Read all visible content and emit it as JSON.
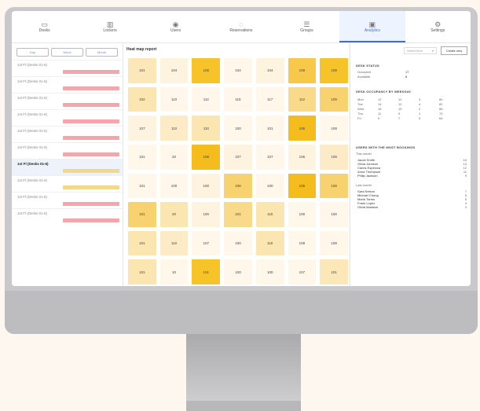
{
  "nav": {
    "items": [
      {
        "label": "Desks",
        "icon": "desk-icon",
        "active": false
      },
      {
        "label": "Lockers",
        "icon": "lockers-icon",
        "active": false
      },
      {
        "label": "Users",
        "icon": "user-icon",
        "active": false
      },
      {
        "label": "Reservations",
        "icon": "reservation-icon",
        "active": false
      },
      {
        "label": "Groups",
        "icon": "groups-icon",
        "active": false
      },
      {
        "label": "Analytics",
        "icon": "analytics-icon",
        "active": true
      },
      {
        "label": "Settings",
        "icon": "settings-icon",
        "active": false
      }
    ]
  },
  "filters": {
    "segments": [
      {
        "label": "Day",
        "active": false
      },
      {
        "label": "Week",
        "active": false
      },
      {
        "label": "Month",
        "active": false
      }
    ]
  },
  "floors": [
    {
      "label": "1st Fl (Desks 01-6)",
      "color": "#f4a6ac",
      "selected": false
    },
    {
      "label": "1st Fl (Desks 01-6)",
      "color": "#f4a6ac",
      "selected": false
    },
    {
      "label": "1st Fl (Desks 01-6)",
      "color": "#f4a6ac",
      "selected": false
    },
    {
      "label": "1st Fl (Desks 01-6)",
      "color": "#f4a6ac",
      "selected": false
    },
    {
      "label": "1st Fl (Desks 01-6)",
      "color": "#f4a6ac",
      "selected": false
    },
    {
      "label": "1st Fl (Desks 01-6)",
      "color": "#f4a6ac",
      "selected": false
    },
    {
      "label": "1st Fl (Desks 01-6)",
      "color": "#f2d88a",
      "selected": true
    },
    {
      "label": "1st Fl (Desks 01-6)",
      "color": "#f2d88a",
      "selected": false
    },
    {
      "label": "1st Fl (Desks 01-6)",
      "color": "#f4a6ac",
      "selected": false
    },
    {
      "label": "1st Fl (Desks 01-6)",
      "color": "#f4a6ac",
      "selected": false
    }
  ],
  "main": {
    "title": "Heat map report"
  },
  "heatmap": [
    [
      {
        "v": "101",
        "c": "#fbe7b8"
      },
      {
        "v": "104",
        "c": "#fef3de"
      },
      {
        "v": "105",
        "c": "#f6c329"
      },
      {
        "v": "104",
        "c": "#fef7ea"
      },
      {
        "v": "104",
        "c": "#fef3de"
      },
      {
        "v": "109",
        "c": "#f7c84a"
      },
      {
        "v": "109",
        "c": "#f6c329"
      }
    ],
    [
      {
        "v": "102",
        "c": "#fbe5b0"
      },
      {
        "v": "110",
        "c": "#fef7ea"
      },
      {
        "v": "112",
        "c": "#fef7ea"
      },
      {
        "v": "115",
        "c": "#fef7ea"
      },
      {
        "v": "117",
        "c": "#fef7ea"
      },
      {
        "v": "112",
        "c": "#f9d98a"
      },
      {
        "v": "109",
        "c": "#f8d26e"
      }
    ],
    [
      {
        "v": "107",
        "c": "#fef3de"
      },
      {
        "v": "110",
        "c": "#fcebc6"
      },
      {
        "v": "110",
        "c": "#fbe5b0"
      },
      {
        "v": "100",
        "c": "#fef7ea"
      },
      {
        "v": "101",
        "c": "#fef7ea"
      },
      {
        "v": "106",
        "c": "#f4bc1c"
      },
      {
        "v": "108",
        "c": "#fef7ea"
      }
    ],
    [
      {
        "v": "101",
        "c": "#fef7ea"
      },
      {
        "v": "20",
        "c": "#fef7ea"
      },
      {
        "v": "108",
        "c": "#f4bc1c"
      },
      {
        "v": "107",
        "c": "#fef3de"
      },
      {
        "v": "107",
        "c": "#fef7ea"
      },
      {
        "v": "106",
        "c": "#fef3de"
      },
      {
        "v": "108",
        "c": "#fcebc6"
      }
    ],
    [
      {
        "v": "101",
        "c": "#fef7ea"
      },
      {
        "v": "100",
        "c": "#fef7ea"
      },
      {
        "v": "100",
        "c": "#fef3de"
      },
      {
        "v": "108",
        "c": "#f8d26e"
      },
      {
        "v": "100",
        "c": "#fef7ea"
      },
      {
        "v": "106",
        "c": "#f4bc1c"
      },
      {
        "v": "108",
        "c": "#f8d26e"
      }
    ],
    [
      {
        "v": "101",
        "c": "#f8d26e"
      },
      {
        "v": "20",
        "c": "#fbe5b0"
      },
      {
        "v": "100",
        "c": "#fef3de"
      },
      {
        "v": "101",
        "c": "#f9d98a"
      },
      {
        "v": "110",
        "c": "#fbe5b0"
      },
      {
        "v": "100",
        "c": "#fef7ea"
      },
      {
        "v": "100",
        "c": "#fef7ea"
      }
    ],
    [
      {
        "v": "101",
        "c": "#fbe5b0"
      },
      {
        "v": "110",
        "c": "#fcebc6"
      },
      {
        "v": "107",
        "c": "#fef7ea"
      },
      {
        "v": "100",
        "c": "#fef7ea"
      },
      {
        "v": "110",
        "c": "#fbe5b0"
      },
      {
        "v": "108",
        "c": "#fef7ea"
      },
      {
        "v": "108",
        "c": "#fef7ea"
      }
    ],
    [
      {
        "v": "101",
        "c": "#fbe5b0"
      },
      {
        "v": "10",
        "c": "#fef7ea"
      },
      {
        "v": "101",
        "c": "#f6c329"
      },
      {
        "v": "100",
        "c": "#fef7ea"
      },
      {
        "v": "100",
        "c": "#fef7ea"
      },
      {
        "v": "107",
        "c": "#fef7ea"
      },
      {
        "v": "101",
        "c": "#fbe7b8"
      }
    ]
  ],
  "controls": {
    "select_label": "Select floor",
    "button_label": "Create new"
  },
  "summary": {
    "title": "DESK STATUS",
    "rows": [
      {
        "label": "Occupied",
        "value": "17"
      },
      {
        "label": "Available",
        "value": "8"
      }
    ]
  },
  "occupancy": {
    "title": "DESK OCCUPANCY BY WEEKDAY",
    "cols": [
      [
        "Mon",
        "Tue",
        "Wed",
        "Thu",
        "Fri"
      ],
      [
        "12",
        "14",
        "16",
        "11",
        "9"
      ],
      [
        "10",
        "12",
        "15",
        "9",
        "7"
      ],
      [
        "3",
        "4",
        "2",
        "1",
        "5"
      ],
      [
        "80",
        "82",
        "88",
        "70",
        "64"
      ]
    ]
  },
  "users": {
    "title": "USERS WITH THE MOST BOOKINGS",
    "group1_label": "This month",
    "group1": [
      {
        "name": "Jacob Smith",
        "value": "16"
      },
      {
        "name": "Olivia Johnson",
        "value": "14"
      },
      {
        "name": "Carlos Espinoza",
        "value": "12"
      },
      {
        "name": "Anna Thompson",
        "value": "11"
      },
      {
        "name": "Philip Jackson",
        "value": "9"
      }
    ],
    "group2_label": "Last month",
    "group2": [
      {
        "name": "Sara Nelson",
        "value": "7"
      },
      {
        "name": "Michael Chung",
        "value": "6"
      },
      {
        "name": "Maria Torres",
        "value": "5"
      },
      {
        "name": "Frank Lopez",
        "value": "4"
      },
      {
        "name": "Olivia Madison",
        "value": "3"
      }
    ]
  }
}
